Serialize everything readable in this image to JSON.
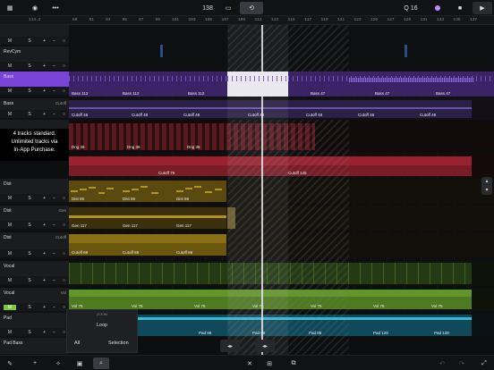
{
  "toolbar": {
    "quantize_value": "138",
    "quantize_grid": "Q 16",
    "colors": {
      "accent": "#a06cf0",
      "record": "#b98cff"
    }
  },
  "ruler": {
    "position": "113.2",
    "bars": [
      "89",
      "91",
      "93",
      "95",
      "97",
      "99",
      "101",
      "103",
      "105",
      "107",
      "109",
      "111",
      "113",
      "115",
      "117",
      "119",
      "121",
      "123",
      "125",
      "127",
      "129",
      "131",
      "133",
      "135",
      "137"
    ]
  },
  "tooltip": {
    "line1": "4 tracks standard.",
    "line2": "Unlimited tracks via",
    "line3": "In-App Purchase."
  },
  "tracks": [
    {
      "name": "",
      "param": "",
      "mute": "M",
      "solo": "S"
    },
    {
      "name": "RevCym",
      "param": "",
      "mute": "M",
      "solo": "S"
    },
    {
      "name": "Bass",
      "param": "",
      "mute": "M",
      "solo": "S"
    },
    {
      "name": "Bass",
      "param": "Cutoff",
      "mute": "M",
      "solo": "S"
    },
    {
      "name": "",
      "param": "",
      "mute": "M",
      "solo": "S"
    },
    {
      "name": "Dist",
      "param": "",
      "mute": "M",
      "solo": "S"
    },
    {
      "name": "Dist",
      "param": "Gen",
      "mute": "M",
      "solo": "S"
    },
    {
      "name": "Dist",
      "param": "Cutoff",
      "mute": "M",
      "solo": "S"
    },
    {
      "name": "Vocal",
      "param": "",
      "mute": "M",
      "solo": "S"
    },
    {
      "name": "Vocal",
      "param": "Vol",
      "mute": "M",
      "solo": "S"
    },
    {
      "name": "Pad",
      "param": "",
      "mute": "M",
      "solo": "S"
    },
    {
      "name": "Pad Bass",
      "param": "",
      "mute": "M",
      "solo": "S"
    }
  ],
  "regions": {
    "bass": [
      "Bass 112",
      "Bass 112",
      "Bass 112",
      "Bass 112",
      "Bass 47",
      "Bass 47",
      "Bass 47"
    ],
    "cutoff48": [
      "Cutoff 48",
      "Cutoff 48",
      "Cutoff 48",
      "Cutoff 48",
      "Cutoff 48",
      "Cutoff 48",
      "Cutoff 48",
      "Cutoff 48",
      "Cutoff 48"
    ],
    "dng": [
      "Dng 36",
      "Dng 36",
      "Dng 36"
    ],
    "cutoff_red": [
      "Cutoff 79",
      "Cutoff 145"
    ],
    "dist": [
      "Dist 59",
      "Dist 59",
      "Dist 59"
    ],
    "gen": [
      "Gen 117",
      "Gen 117",
      "Gen 117"
    ],
    "dcut": [
      "Cutoff 69",
      "Cutoff 69",
      "Cutoff 69"
    ],
    "vocal": [
      "Vol 75",
      "Vol 75",
      "Vol 75",
      "Vol 75",
      "Vol 75",
      "Vol 75",
      "Vol 75",
      "Vol 75",
      "Vol 75",
      "Vol 75",
      "Vol 75",
      "Vol 75"
    ],
    "pad": [
      "Pad 88",
      "Pad 88",
      "Pad 88",
      "Pad 128",
      "Pad 128"
    ]
  },
  "zoom_panel": {
    "title": "ZOOM",
    "loop": "Loop",
    "all": "All",
    "selection": "Selection"
  }
}
